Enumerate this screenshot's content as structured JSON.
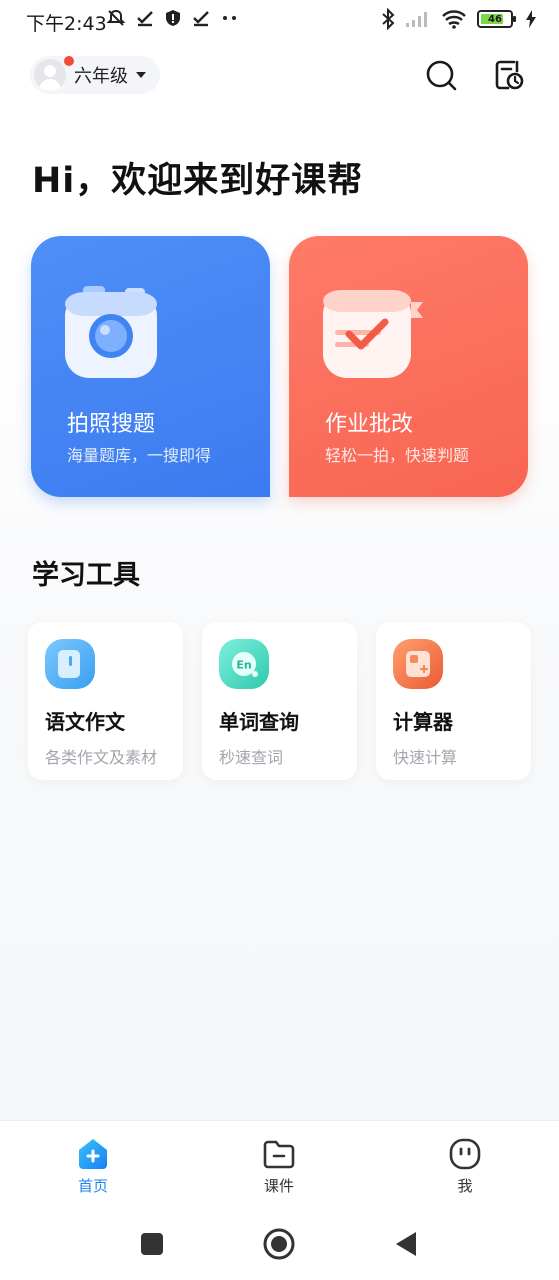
{
  "status_bar": {
    "time": "下午2:43",
    "battery_level": "46"
  },
  "header": {
    "grade": "六年级"
  },
  "greeting": "Hi，欢迎来到好课帮",
  "feature_cards": [
    {
      "title": "拍照搜题",
      "subtitle": "海量题库，一搜即得",
      "color": "#4a89f5"
    },
    {
      "title": "作业批改",
      "subtitle": "轻松一拍，快速判题",
      "color": "#fc705e"
    }
  ],
  "tools_section": {
    "title": "学习工具",
    "items": [
      {
        "name": "语文作文",
        "desc": "各类作文及素材",
        "icon": "book-icon",
        "color": "#4fb3f7"
      },
      {
        "name": "单词查询",
        "desc": "秒速查词",
        "icon": "en-word-icon",
        "color": "#4fd8c0"
      },
      {
        "name": "计算器",
        "desc": "快速计算",
        "icon": "calculator-icon",
        "color": "#f2744a"
      }
    ]
  },
  "bottom_nav": [
    {
      "label": "首页",
      "icon": "home-icon",
      "active": true
    },
    {
      "label": "课件",
      "icon": "folder-icon",
      "active": false
    },
    {
      "label": "我",
      "icon": "face-icon",
      "active": false
    }
  ],
  "accent_color": "#1f86f2"
}
